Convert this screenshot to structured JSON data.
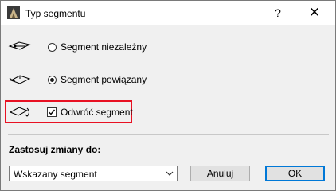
{
  "window": {
    "title": "Typ segmentu",
    "help_glyph": "?",
    "close_glyph": "✕"
  },
  "options": [
    {
      "label": "Segment niezależny",
      "selected": false,
      "icon": "independent-segment-icon"
    },
    {
      "label": "Segment powiązany",
      "selected": true,
      "icon": "linked-segment-icon"
    }
  ],
  "reverse": {
    "label": "Odwróć segment",
    "checked": true,
    "icon": "reverse-segment-icon"
  },
  "apply": {
    "label": "Zastosuj zmiany do:",
    "selected_value": "Wskazany segment"
  },
  "buttons": {
    "cancel": "Anuluj",
    "ok": "OK"
  },
  "colors": {
    "highlight": "#e81123",
    "default_button_border": "#0078d7"
  }
}
